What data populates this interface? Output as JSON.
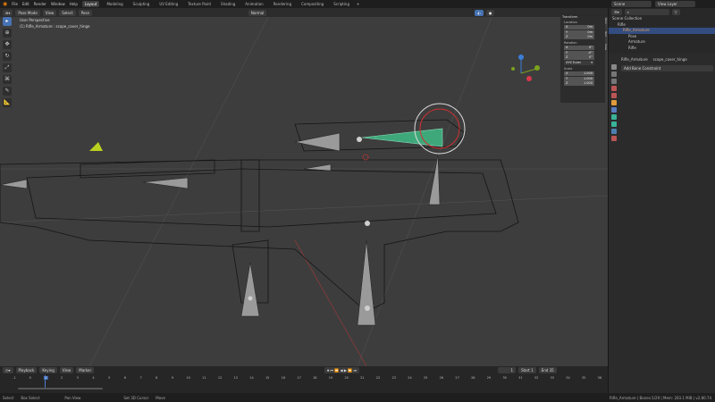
{
  "menu": {
    "items": [
      "File",
      "Edit",
      "Render",
      "Window",
      "Help"
    ],
    "workspaces": [
      "Layout",
      "Modeling",
      "Sculpting",
      "UV Editing",
      "Texture Paint",
      "Shading",
      "Animation",
      "Rendering",
      "Compositing",
      "Scripting"
    ],
    "active_workspace": "Layout",
    "add_tab": "+"
  },
  "viewport_header": {
    "mode": "Pose Mode",
    "menus": [
      "View",
      "Select",
      "Pose"
    ],
    "orientation": "Normal"
  },
  "viewport": {
    "view_name": "User Perspective",
    "object_info": "(1) Rifle_Armature : scope_cover_hinge"
  },
  "npanel": {
    "title": "Transform",
    "location_label": "Location",
    "location": [
      {
        "axis": "X",
        "value": "0m"
      },
      {
        "axis": "Y",
        "value": "0m"
      },
      {
        "axis": "Z",
        "value": "0m"
      }
    ],
    "rotation_label": "Rotation",
    "rotation": [
      {
        "axis": "X",
        "value": "0°"
      },
      {
        "axis": "Y",
        "value": "-0°"
      },
      {
        "axis": "Z",
        "value": "0°"
      }
    ],
    "rotation_mode": "XYZ Euler",
    "scale_label": "Scale",
    "scale": [
      {
        "axis": "X",
        "value": "1.000"
      },
      {
        "axis": "Y",
        "value": "1.000"
      },
      {
        "axis": "Z",
        "value": "1.000"
      }
    ],
    "tabs": [
      "Item",
      "Tool",
      "View"
    ]
  },
  "topright": {
    "scene": "Scene",
    "view_layer": "View Layer"
  },
  "outliner": {
    "rows": [
      "Scene Collection",
      "Rifle",
      "Rifle_Armature",
      "Pose",
      "Armature",
      "Rifle"
    ]
  },
  "properties": {
    "object": "Rifle_Armature",
    "bone": "scope_cover_hinge",
    "add_constraint": "Add Bone Constraint"
  },
  "timeline": {
    "menus": [
      "Playback",
      "Keying",
      "View",
      "Marker"
    ],
    "current_frame": "1",
    "start_label": "Start",
    "start": "1",
    "end_label": "End",
    "end": "35",
    "frames": [
      "-1",
      "0",
      "1",
      "2",
      "3",
      "4",
      "5",
      "6",
      "7",
      "8",
      "9",
      "10",
      "11",
      "12",
      "13",
      "14",
      "15",
      "16",
      "17",
      "18",
      "19",
      "20",
      "21",
      "22",
      "23",
      "24",
      "25",
      "26",
      "27",
      "28",
      "29",
      "30",
      "31",
      "32",
      "33",
      "34",
      "35",
      "36"
    ]
  },
  "statusbar": {
    "items": [
      "Select",
      "Box Select",
      "Pan View",
      "Set 3D Cursor",
      "Move"
    ],
    "info": "Rifle_Armature | Bones:1/29 | Mem: 203.1 MiB | v2.80.74"
  }
}
